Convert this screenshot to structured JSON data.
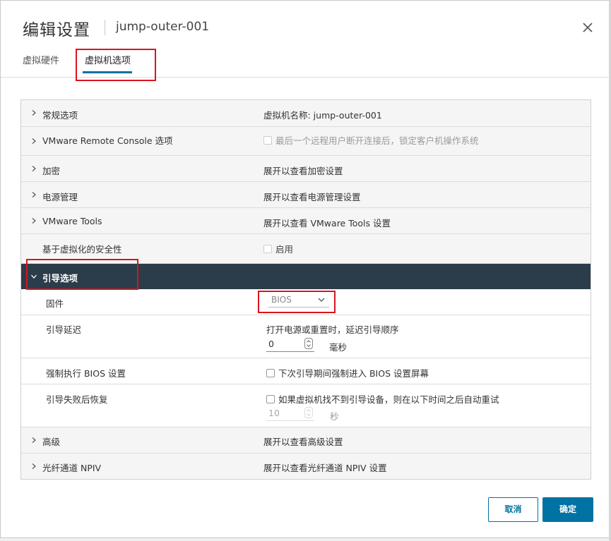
{
  "dialog": {
    "title": "编辑设置",
    "subtitle": "jump-outer-001",
    "close_icon": "close-icon"
  },
  "tabs": [
    {
      "label": "虚拟硬件",
      "active": false
    },
    {
      "label": "虚拟机选项",
      "active": true
    }
  ],
  "rows": {
    "general": {
      "label": "常规选项",
      "value": "虚拟机名称: jump-outer-001"
    },
    "vmrc": {
      "label": "VMware Remote Console 选项",
      "value": "最后一个远程用户断开连接后，锁定客户机操作系统"
    },
    "encryption": {
      "label": "加密",
      "value": "展开以查看加密设置"
    },
    "power": {
      "label": "电源管理",
      "value": "展开以查看电源管理设置"
    },
    "tools": {
      "label": "VMware Tools",
      "value": "展开以查看 VMware Tools 设置"
    },
    "vbs": {
      "label": "基于虚拟化的安全性",
      "value": "启用"
    },
    "boot": {
      "label": "引导选项"
    },
    "firmware": {
      "label": "固件",
      "value": "BIOS"
    },
    "boot_delay": {
      "label": "引导延迟",
      "desc": "打开电源或重置时，延迟引导顺序",
      "value": "0",
      "unit": "毫秒"
    },
    "force_bios": {
      "label": "强制执行 BIOS 设置",
      "value": "下次引导期间强制进入 BIOS 设置屏幕"
    },
    "failed_boot": {
      "label": "引导失败后恢复",
      "value": "如果虚拟机找不到引导设备，则在以下时间之后自动重试",
      "seconds": "10",
      "unit": "秒"
    },
    "advanced": {
      "label": "高级",
      "value": "展开以查看高级设置"
    },
    "npiv": {
      "label": "光纤通道 NPIV",
      "value": "展开以查看光纤通道 NPIV 设置"
    }
  },
  "buttons": {
    "cancel": "取消",
    "ok": "确定"
  },
  "colors": {
    "accent": "#0072a3",
    "highlight_row": "#2b3d4a",
    "annotation_red": "#d9141f"
  }
}
